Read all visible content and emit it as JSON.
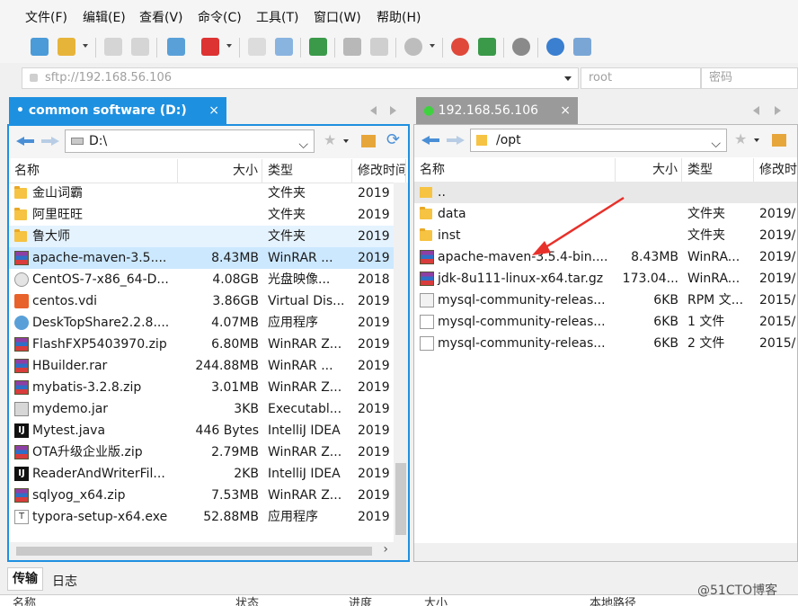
{
  "menu": [
    "文件(F)",
    "编辑(E)",
    "查看(V)",
    "命令(C)",
    "工具(T)",
    "窗口(W)",
    "帮助(H)"
  ],
  "address": {
    "host": "sftp://192.168.56.106",
    "user": "root",
    "password_placeholder": "密码"
  },
  "left_tab": {
    "label": "common software (D:)",
    "close": "×"
  },
  "right_tab": {
    "label": "192.168.56.106",
    "close": "×"
  },
  "left_panel": {
    "path": "D:\\",
    "columns": [
      "名称",
      "大小",
      "类型",
      "修改时间"
    ],
    "rows": [
      {
        "name": "金山词霸",
        "size": "",
        "type": "文件夹",
        "date": "2019",
        "icon": "folder-icon"
      },
      {
        "name": "阿里旺旺",
        "size": "",
        "type": "文件夹",
        "date": "2019",
        "icon": "folder-icon"
      },
      {
        "name": "鲁大师",
        "size": "",
        "type": "文件夹",
        "date": "2019",
        "icon": "folder-icon"
      },
      {
        "name": "apache-maven-3.5....",
        "size": "8.43MB",
        "type": "WinRAR ...",
        "date": "2019",
        "icon": "rar-icon"
      },
      {
        "name": "CentOS-7-x86_64-D...",
        "size": "4.08GB",
        "type": "光盘映像...",
        "date": "2018",
        "icon": "disc-image-icon"
      },
      {
        "name": "centos.vdi",
        "size": "3.86GB",
        "type": "Virtual Dis...",
        "date": "2019",
        "icon": "virtual-disk-icon"
      },
      {
        "name": "DeskTopShare2.2.8....",
        "size": "4.07MB",
        "type": "应用程序",
        "date": "2019",
        "icon": "application-icon"
      },
      {
        "name": "FlashFXP5403970.zip",
        "size": "6.80MB",
        "type": "WinRAR Z...",
        "date": "2019",
        "icon": "rar-icon"
      },
      {
        "name": "HBuilder.rar",
        "size": "244.88MB",
        "type": "WinRAR ...",
        "date": "2019",
        "icon": "rar-icon"
      },
      {
        "name": "mybatis-3.2.8.zip",
        "size": "3.01MB",
        "type": "WinRAR Z...",
        "date": "2019",
        "icon": "rar-icon"
      },
      {
        "name": "mydemo.jar",
        "size": "3KB",
        "type": "Executabl...",
        "date": "2019",
        "icon": "jar-icon"
      },
      {
        "name": "Mytest.java",
        "size": "446 Bytes",
        "type": "IntelliJ IDEA",
        "date": "2019",
        "icon": "java-file-icon"
      },
      {
        "name": "OTA升级企业版.zip",
        "size": "2.79MB",
        "type": "WinRAR Z...",
        "date": "2019",
        "icon": "rar-icon"
      },
      {
        "name": "ReaderAndWriterFil...",
        "size": "2KB",
        "type": "IntelliJ IDEA",
        "date": "2019",
        "icon": "java-file-icon"
      },
      {
        "name": "sqlyog_x64.zip",
        "size": "7.53MB",
        "type": "WinRAR Z...",
        "date": "2019",
        "icon": "rar-icon"
      },
      {
        "name": "typora-setup-x64.exe",
        "size": "52.88MB",
        "type": "应用程序",
        "date": "2019",
        "icon": "typora-icon"
      }
    ]
  },
  "right_panel": {
    "path": "/opt",
    "columns": [
      "名称",
      "大小",
      "类型",
      "修改时间"
    ],
    "rows": [
      {
        "name": "..",
        "size": "",
        "type": "",
        "date": "",
        "icon": "parent-folder-icon"
      },
      {
        "name": "data",
        "size": "",
        "type": "文件夹",
        "date": "2019/",
        "icon": "folder-icon"
      },
      {
        "name": "inst",
        "size": "",
        "type": "文件夹",
        "date": "2019/",
        "icon": "folder-icon"
      },
      {
        "name": "apache-maven-3.5.4-bin....",
        "size": "8.43MB",
        "type": "WinRA...",
        "date": "2019/",
        "icon": "rar-icon"
      },
      {
        "name": "jdk-8u111-linux-x64.tar.gz",
        "size": "173.04...",
        "type": "WinRA...",
        "date": "2019/",
        "icon": "rar-icon"
      },
      {
        "name": "mysql-community-releas...",
        "size": "6KB",
        "type": "RPM 文...",
        "date": "2015/",
        "icon": "rpm-icon"
      },
      {
        "name": "mysql-community-releas...",
        "size": "6KB",
        "type": "1 文件",
        "date": "2015/",
        "icon": "file-icon"
      },
      {
        "name": "mysql-community-releas...",
        "size": "6KB",
        "type": "2 文件",
        "date": "2015/",
        "icon": "file-icon"
      }
    ]
  },
  "bottom_tabs": [
    "传输",
    "日志"
  ],
  "queue_columns": [
    "名称",
    "状态",
    "进度",
    "大小",
    "本地路径"
  ],
  "watermark": "@51CTO博客",
  "colors": {
    "accent": "#1e90e0",
    "arrow": "#e8302a",
    "selected_row": "#cce8ff"
  }
}
